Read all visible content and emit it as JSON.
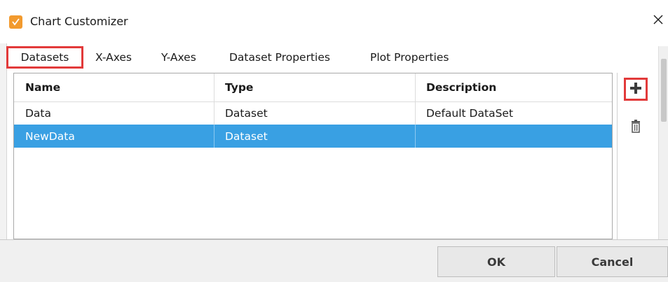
{
  "window": {
    "title": "Chart Customizer",
    "close_glyph": "×",
    "app_icon": "chart-customizer-icon"
  },
  "tabs": [
    {
      "label": "Datasets",
      "active": true
    },
    {
      "label": "X-Axes",
      "active": false
    },
    {
      "label": "Y-Axes",
      "active": false
    },
    {
      "label": "Dataset Properties",
      "active": false
    },
    {
      "label": "Plot Properties",
      "active": false
    }
  ],
  "table": {
    "columns": [
      "Name",
      "Type",
      "Description"
    ],
    "rows": [
      {
        "name": "Data",
        "type": "Dataset",
        "description": "Default DataSet",
        "selected": false
      },
      {
        "name": "NewData",
        "type": "Dataset",
        "description": "",
        "selected": true
      }
    ]
  },
  "side_actions": {
    "add_icon": "plus-icon",
    "delete_icon": "trash-icon"
  },
  "buttons": {
    "ok": "OK",
    "cancel": "Cancel"
  },
  "colors": {
    "accent_highlight": "#e23a3a",
    "selection": "#39a0e3",
    "app_icon": "#f29a2e"
  }
}
